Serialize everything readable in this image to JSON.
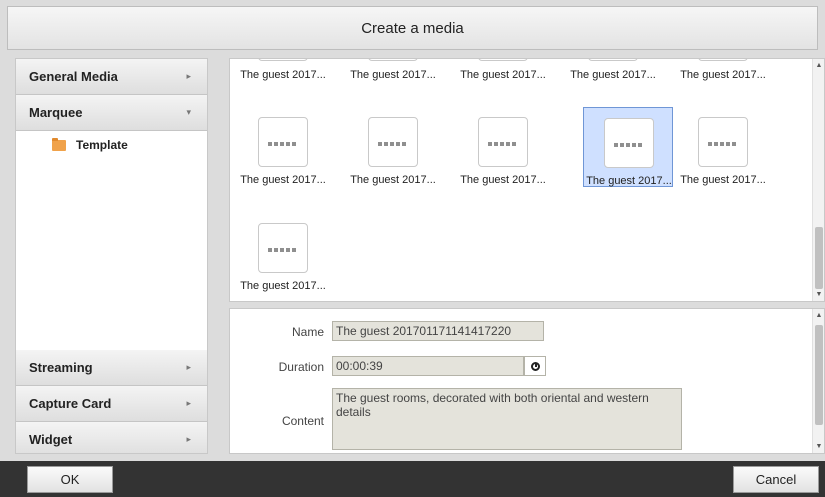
{
  "dialog": {
    "title": "Create a media"
  },
  "sidebar": {
    "general_media": "General Media",
    "marquee": "Marquee",
    "template": "Template",
    "streaming": "Streaming",
    "capture_card": "Capture Card",
    "widget": "Widget",
    "arrow_collapsed": "▸",
    "arrow_expanded": "▾"
  },
  "gallery": {
    "top_row": [
      "The guest 2017...",
      "The guest 2017...",
      "The guest 2017...",
      "The guest 2017...",
      "The guest 2017..."
    ],
    "mid_row": [
      "The guest 2017...",
      "The guest 2017...",
      "The guest 2017...",
      "The guest 2017...",
      "The guest 2017..."
    ],
    "bottom_row": [
      "The guest 2017..."
    ],
    "selected_index": 3
  },
  "details": {
    "name_label": "Name",
    "name_value": "The guest 201701171141417220",
    "duration_label": "Duration",
    "duration_value": "00:00:39",
    "content_label": "Content",
    "content_value": "The guest rooms, decorated with both oriental and western details"
  },
  "footer": {
    "ok": "OK",
    "cancel": "Cancel"
  },
  "colors": {
    "selection": "#cfe0ff",
    "folder": "#f0a24a",
    "footer": "#333333"
  }
}
